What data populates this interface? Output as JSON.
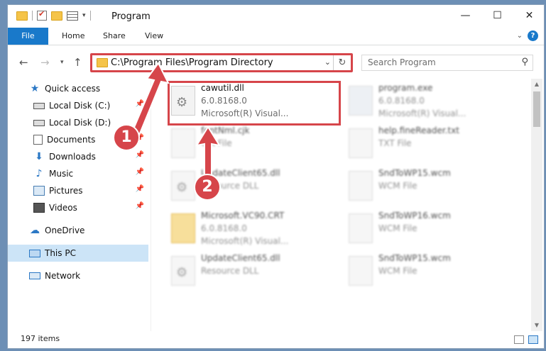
{
  "window": {
    "title": "Program",
    "minimize": "—",
    "maximize": "☐",
    "close": "✕"
  },
  "ribbon": {
    "tabs": [
      "File",
      "Home",
      "Share",
      "View"
    ]
  },
  "address": {
    "path": "C:\\Program Files\\Program Directory",
    "search_placeholder": "Search Program"
  },
  "nav": {
    "items": [
      {
        "label": "Quick access",
        "icon": "star-icon"
      },
      {
        "label": "Local Disk (C:)",
        "icon": "drive-icon"
      },
      {
        "label": "Local Disk (D:)",
        "icon": "drive-icon"
      },
      {
        "label": "Documents",
        "icon": "documents-icon"
      },
      {
        "label": "Downloads",
        "icon": "download-icon"
      },
      {
        "label": "Music",
        "icon": "music-icon"
      },
      {
        "label": "Pictures",
        "icon": "pictures-icon"
      },
      {
        "label": "Videos",
        "icon": "videos-icon"
      },
      {
        "label": "OneDrive",
        "icon": "cloud-icon"
      },
      {
        "label": "This PC",
        "icon": "computer-icon"
      },
      {
        "label": "Network",
        "icon": "network-icon"
      }
    ]
  },
  "files": [
    {
      "name": "cawutil.dll",
      "line2": "6.0.8168.0",
      "line3": "Microsoft(R) Visual..."
    },
    {
      "name": "program.exe",
      "line2": "6.0.8168.0",
      "line3": "Microsoft(R) Visual..."
    },
    {
      "name": "fontNml.cjk",
      "line2": "CJK File",
      "line3": ""
    },
    {
      "name": "help.fineReader.txt",
      "line2": "TXT File",
      "line3": ""
    },
    {
      "name": "UpdateClient65.dll",
      "line2": "Resource DLL",
      "line3": ""
    },
    {
      "name": "SndToWP15.wcm",
      "line2": "WCM File",
      "line3": ""
    },
    {
      "name": "Microsoft.VC90.CRT",
      "line2": "6.0.8168.0",
      "line3": "Microsoft(R) Visual..."
    },
    {
      "name": "SndToWP16.wcm",
      "line2": "WCM File",
      "line3": ""
    },
    {
      "name": "UpdateClient65.dll",
      "line2": "Resource DLL",
      "line3": ""
    },
    {
      "name": "SndToWP15.wcm",
      "line2": "WCM File",
      "line3": ""
    }
  ],
  "status": {
    "item_count": "197 items"
  },
  "callouts": {
    "one": "1",
    "two": "2"
  },
  "colors": {
    "accent": "#1979ca",
    "callout": "#d6454a",
    "selected_nav": "#cce4f7"
  }
}
